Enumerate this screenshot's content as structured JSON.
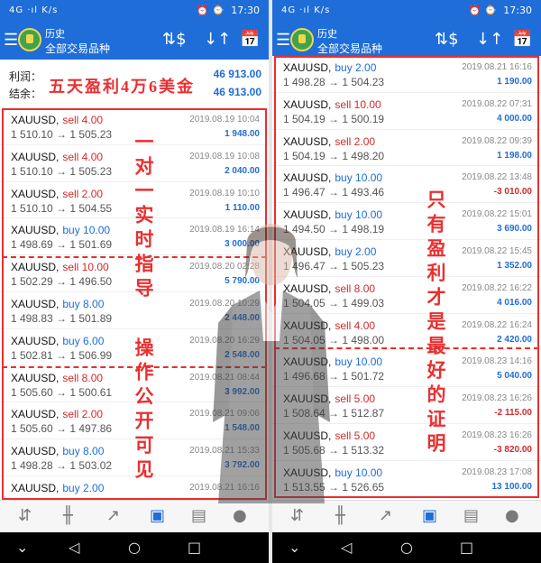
{
  "status_bar": {
    "network": "4G ·ıl K/s",
    "icons": "⏰ ⌚",
    "time": "17:30"
  },
  "appbar": {
    "title": "历史",
    "subtitle": "全部交易品种"
  },
  "summary": {
    "profit_label": "利润：",
    "profit_value": "46 913.00",
    "balance_label": "结余：",
    "balance_value": "46 913.00"
  },
  "overlay": {
    "headline": "五天盈利4万6美金",
    "left_vertical_1": "一对一实时指导",
    "left_vertical_2": "操作公开可见",
    "right_vertical": "只有盈利才是最好的证明"
  },
  "left_list": [
    {
      "symbol": "XAUUSD,",
      "side": "sell 4.00",
      "type": "sell",
      "prices": "1 510.10 → 1 505.23",
      "date": "2019.08.19 10:04",
      "pl": "1 948.00",
      "pl_sign": "pos"
    },
    {
      "symbol": "XAUUSD,",
      "side": "sell 4.00",
      "type": "sell",
      "prices": "1 510.10 → 1 505.23",
      "date": "2019.08.19 10:08",
      "pl": "2 040.00",
      "pl_sign": "pos"
    },
    {
      "symbol": "XAUUSD,",
      "side": "sell 2.00",
      "type": "sell",
      "prices": "1 510.10 → 1 504.55",
      "date": "2019.08.19 10:10",
      "pl": "1 110.00",
      "pl_sign": "pos"
    },
    {
      "symbol": "XAUUSD,",
      "side": "buy 10.00",
      "type": "buy",
      "prices": "1 498.69 → 1 501.69",
      "date": "2019.08.19 16:14",
      "pl": "3 000.00",
      "pl_sign": "pos"
    },
    {
      "symbol": "XAUUSD,",
      "side": "sell 10.00",
      "type": "sell",
      "prices": "1 502.29 → 1 496.50",
      "date": "2019.08.20 02:28",
      "pl": "5 790.00",
      "pl_sign": "pos"
    },
    {
      "symbol": "XAUUSD,",
      "side": "buy 8.00",
      "type": "buy",
      "prices": "1 498.83 → 1 501.89",
      "date": "2019.08.20 10:29",
      "pl": "2 448.00",
      "pl_sign": "pos"
    },
    {
      "symbol": "XAUUSD,",
      "side": "buy 6.00",
      "type": "buy",
      "prices": "1 502.81 → 1 506.99",
      "date": "2019.08.20 16:29",
      "pl": "2 548.00",
      "pl_sign": "pos"
    },
    {
      "symbol": "XAUUSD,",
      "side": "sell 8.00",
      "type": "sell",
      "prices": "1 505.60 → 1 500.61",
      "date": "2019.08.21 08:44",
      "pl": "3 992.00",
      "pl_sign": "pos"
    },
    {
      "symbol": "XAUUSD,",
      "side": "sell 2.00",
      "type": "sell",
      "prices": "1 505.60 → 1 497.86",
      "date": "2019.08.21 09:06",
      "pl": "1 548.00",
      "pl_sign": "pos"
    },
    {
      "symbol": "XAUUSD,",
      "side": "buy 8.00",
      "type": "buy",
      "prices": "1 498.28 → 1 503.02",
      "date": "2019.08.21 15:33",
      "pl": "3 792.00",
      "pl_sign": "pos"
    },
    {
      "symbol": "XAUUSD,",
      "side": "buy 2.00",
      "type": "buy",
      "prices": "",
      "date": "2019.08.21 16:16",
      "pl": "",
      "pl_sign": "pos"
    }
  ],
  "right_list": [
    {
      "symbol": "XAUUSD,",
      "side": "buy 2.00",
      "type": "buy",
      "prices": "1 498.28 → 1 504.23",
      "date": "2019.08.21 16:16",
      "pl": "1 190.00",
      "pl_sign": "pos"
    },
    {
      "symbol": "XAUUSD,",
      "side": "sell 10.00",
      "type": "sell",
      "prices": "1 504.19 → 1 500.19",
      "date": "2019.08.22 07:31",
      "pl": "4 000.00",
      "pl_sign": "pos"
    },
    {
      "symbol": "XAUUSD,",
      "side": "sell 2.00",
      "type": "sell",
      "prices": "1 504.19 → 1 498.20",
      "date": "2019.08.22 09:39",
      "pl": "1 198.00",
      "pl_sign": "pos"
    },
    {
      "symbol": "XAUUSD,",
      "side": "buy 10.00",
      "type": "buy",
      "prices": "1 496.47 → 1 493.46",
      "date": "2019.08.22 13:48",
      "pl": "-3 010.00",
      "pl_sign": "neg"
    },
    {
      "symbol": "XAUUSD,",
      "side": "buy 10.00",
      "type": "buy",
      "prices": "1 494.50 → 1 498.19",
      "date": "2019.08.22 15:01",
      "pl": "3 690.00",
      "pl_sign": "pos"
    },
    {
      "symbol": "XAUUSD,",
      "side": "buy 2.00",
      "type": "buy",
      "prices": "1 496.47 → 1 505.23",
      "date": "2019.08.22 15:45",
      "pl": "1 352.00",
      "pl_sign": "pos"
    },
    {
      "symbol": "XAUUSD,",
      "side": "sell 8.00",
      "type": "sell",
      "prices": "1 504.05 → 1 499.03",
      "date": "2019.08.22 16:22",
      "pl": "4 016.00",
      "pl_sign": "pos"
    },
    {
      "symbol": "XAUUSD,",
      "side": "sell 4.00",
      "type": "sell",
      "prices": "1 504.05 → 1 498.00",
      "date": "2019.08.22 16:24",
      "pl": "2 420.00",
      "pl_sign": "pos"
    },
    {
      "symbol": "XAUUSD,",
      "side": "buy 10.00",
      "type": "buy",
      "prices": "1 496.68 → 1 501.72",
      "date": "2019.08.23 14:16",
      "pl": "5 040.00",
      "pl_sign": "pos"
    },
    {
      "symbol": "XAUUSD,",
      "side": "sell 5.00",
      "type": "sell",
      "prices": "1 508.64 → 1 512.87",
      "date": "2019.08.23 16:26",
      "pl": "-2 115.00",
      "pl_sign": "neg"
    },
    {
      "symbol": "XAUUSD,",
      "side": "sell 5.00",
      "type": "sell",
      "prices": "1 505.68 → 1 513.32",
      "date": "2019.08.23 16:26",
      "pl": "-3 820.00",
      "pl_sign": "neg"
    },
    {
      "symbol": "XAUUSD,",
      "side": "buy 10.00",
      "type": "buy",
      "prices": "1 513.55 → 1 526.65",
      "date": "2019.08.23 17:08",
      "pl": "13 100.00",
      "pl_sign": "pos"
    }
  ],
  "icons": {
    "menu": "menu-icon",
    "currency_exchange": "currency-exchange-icon",
    "sort": "sort-icon",
    "calendar": "calendar-icon",
    "quotes": "quotes-icon",
    "charts": "candlestick-chart-icon",
    "trade": "trade-icon",
    "history": "history-inbox-icon",
    "news": "news-icon",
    "chat": "chat-icon"
  },
  "colors": {
    "header": "#1e6dd8",
    "buy": "#1e6dd8",
    "sell": "#d12a2a",
    "annotation": "#ea2f2f"
  }
}
